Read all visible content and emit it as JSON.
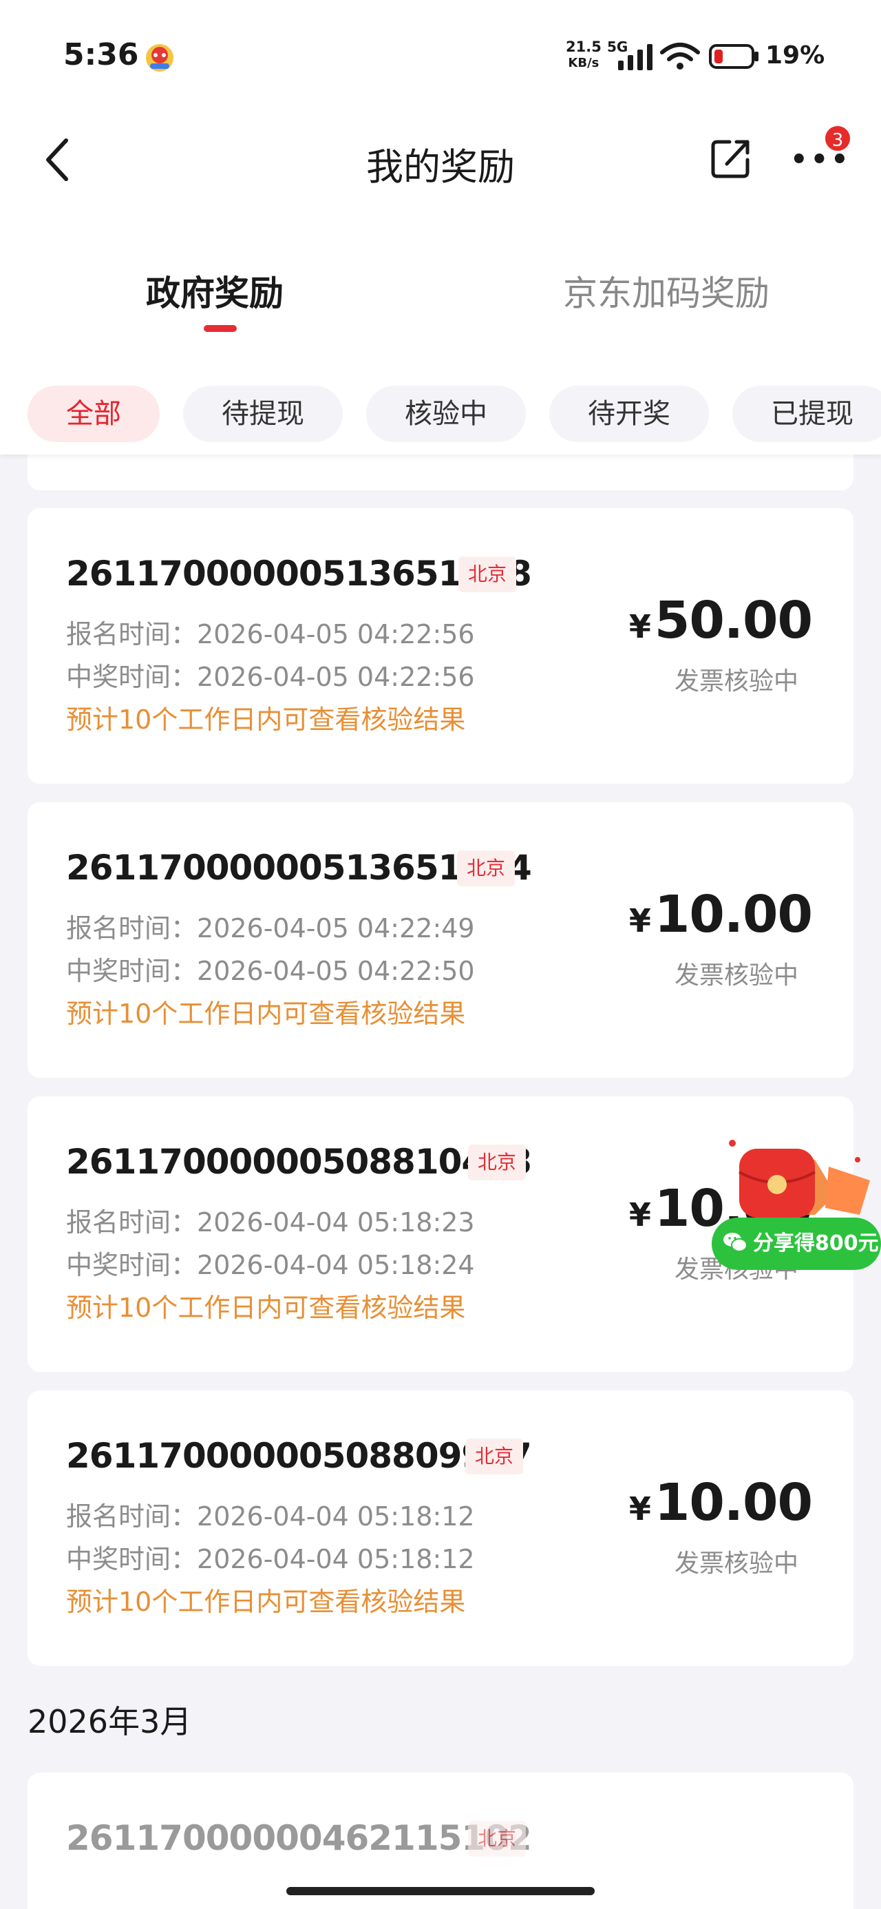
{
  "status_bar": {
    "time": "5:36",
    "net_speed_top": "21.5",
    "net_speed_bottom": "KB/s",
    "network": "5G",
    "battery": "19%",
    "battery_color": "#e02020"
  },
  "nav": {
    "title": "我的奖励",
    "badge": "3"
  },
  "tabs": {
    "active": "政府奖励",
    "inactive": "京东加码奖励"
  },
  "filters": [
    "全部",
    "待提现",
    "核验中",
    "待开奖",
    "已提现"
  ],
  "labels": {
    "signup": "报名时间：",
    "win": "中奖时间：",
    "currency": "¥"
  },
  "rewards": [
    {
      "id": "26117000000513651418",
      "city": "北京",
      "signup_time": "2026-04-05 04:22:56",
      "win_time": "2026-04-05 04:22:56",
      "note": "预计10个工作日内可查看核验结果",
      "amount": "50.00",
      "status": "发票核验中"
    },
    {
      "id": "26117000000513651714",
      "city": "北京",
      "signup_time": "2026-04-05 04:22:49",
      "win_time": "2026-04-05 04:22:50",
      "note": "预计10个工作日内可查看核验结果",
      "amount": "10.00",
      "status": "发票核验中"
    },
    {
      "id": "26117000000508810468",
      "city": "北京",
      "signup_time": "2026-04-04 05:18:23",
      "win_time": "2026-04-04 05:18:24",
      "note": "预计10个工作日内可查看核验结果",
      "amount": "10.00",
      "status": "发票核验中"
    },
    {
      "id": "26117000000508809917",
      "city": "北京",
      "signup_time": "2026-04-04 05:18:12",
      "win_time": "2026-04-04 05:18:12",
      "note": "预计10个工作日内可查看核验结果",
      "amount": "10.00",
      "status": "发票核验中"
    }
  ],
  "month_header": "2026年3月",
  "next_reward": {
    "id": "26117000000462115102",
    "city": "北京"
  },
  "floating_share": {
    "label": "分享得800元"
  },
  "colors": {
    "accent": "#e52d35",
    "note": "#e88f35",
    "share_green": "#2cc23e"
  }
}
